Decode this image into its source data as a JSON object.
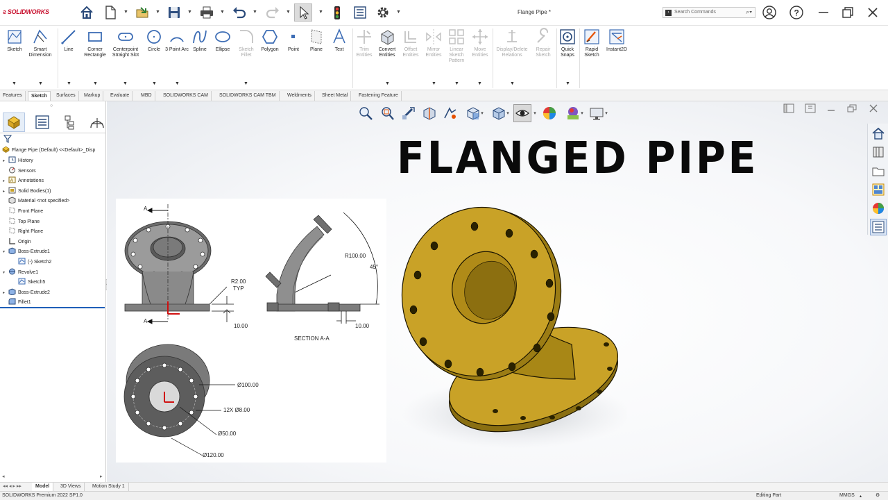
{
  "app": {
    "brand": "SOLIDWORKS",
    "document_title": "Flange Pipe *",
    "search_placeholder": "Search Commands"
  },
  "ribbon": {
    "sketch_group": [
      {
        "label": "Sketch",
        "enabled": true,
        "icon": "sketch-icon"
      },
      {
        "label": "Smart Dimension",
        "enabled": true,
        "icon": "smart-dimension-icon"
      },
      {
        "label": "Line",
        "enabled": true,
        "icon": "line-icon"
      },
      {
        "label": "Corner Rectangle",
        "enabled": true,
        "icon": "rectangle-icon"
      },
      {
        "label": "Centerpoint Straight Slot",
        "enabled": true,
        "icon": "slot-icon"
      },
      {
        "label": "Circle",
        "enabled": true,
        "icon": "circle-icon"
      },
      {
        "label": "3 Point Arc",
        "enabled": true,
        "icon": "arc-icon"
      },
      {
        "label": "Spline",
        "enabled": true,
        "icon": "spline-icon"
      },
      {
        "label": "Ellipse",
        "enabled": true,
        "icon": "ellipse-icon"
      },
      {
        "label": "Sketch Fillet",
        "enabled": false,
        "icon": "sketch-fillet-icon"
      },
      {
        "label": "Polygon",
        "enabled": true,
        "icon": "polygon-icon"
      },
      {
        "label": "Point",
        "enabled": true,
        "icon": "point-icon"
      },
      {
        "label": "Plane",
        "enabled": true,
        "icon": "plane-icon"
      },
      {
        "label": "Text",
        "enabled": true,
        "icon": "text-icon"
      }
    ],
    "entities_group": [
      {
        "label": "Trim Entities",
        "enabled": false,
        "icon": "trim-icon"
      },
      {
        "label": "Convert Entities",
        "enabled": true,
        "icon": "convert-entities-icon"
      },
      {
        "label": "Offset Entities",
        "enabled": false,
        "icon": "offset-icon"
      },
      {
        "label": "Mirror Entities",
        "enabled": false,
        "icon": "mirror-icon"
      },
      {
        "label": "Linear Sketch Pattern",
        "enabled": false,
        "icon": "linear-pattern-icon"
      },
      {
        "label": "Move Entities",
        "enabled": false,
        "icon": "move-icon"
      }
    ],
    "relations_group": [
      {
        "label": "Display/Delete Relations",
        "enabled": false,
        "icon": "relations-icon"
      },
      {
        "label": "Repair Sketch",
        "enabled": false,
        "icon": "repair-icon"
      }
    ],
    "snap_group": [
      {
        "label": "Quick Snaps",
        "enabled": true,
        "icon": "quick-snaps-icon"
      },
      {
        "label": "Rapid Sketch",
        "enabled": true,
        "icon": "rapid-sketch-icon"
      },
      {
        "label": "Instant2D",
        "enabled": true,
        "icon": "instant2d-icon"
      }
    ]
  },
  "tabs": [
    "Features",
    "Sketch",
    "Surfaces",
    "Markup",
    "Evaluate",
    "MBD",
    "SOLIDWORKS CAM",
    "SOLIDWORKS CAM TBM",
    "Weldments",
    "Sheet Metal",
    "Fastening Feature"
  ],
  "active_tab": "Sketch",
  "tree": {
    "root": "Flange Pipe (Default) <<Default>_Disp",
    "items": [
      {
        "label": "History",
        "expandable": true,
        "icon": "history-icon"
      },
      {
        "label": "Sensors",
        "expandable": false,
        "icon": "sensors-icon"
      },
      {
        "label": "Annotations",
        "expandable": true,
        "icon": "annotations-icon"
      },
      {
        "label": "Solid Bodies(1)",
        "expandable": true,
        "icon": "solid-bodies-icon"
      },
      {
        "label": "Material <not specified>",
        "expandable": false,
        "icon": "material-icon"
      },
      {
        "label": "Front Plane",
        "expandable": false,
        "icon": "plane-icon"
      },
      {
        "label": "Top Plane",
        "expandable": false,
        "icon": "plane-icon"
      },
      {
        "label": "Right Plane",
        "expandable": false,
        "icon": "plane-icon"
      },
      {
        "label": "Origin",
        "expandable": false,
        "icon": "origin-icon"
      },
      {
        "label": "Boss-Extrude1",
        "expandable": true,
        "expanded": true,
        "icon": "extrude-icon"
      },
      {
        "label": "(-) Sketch2",
        "expandable": false,
        "indent": 1,
        "icon": "sketch-icon"
      },
      {
        "label": "Revolve1",
        "expandable": true,
        "expanded": true,
        "icon": "revolve-icon"
      },
      {
        "label": "Sketch5",
        "expandable": false,
        "indent": 1,
        "icon": "sketch-icon"
      },
      {
        "label": "Boss-Extrude2",
        "expandable": true,
        "icon": "extrude-icon"
      },
      {
        "label": "Fillet1",
        "expandable": false,
        "icon": "fillet-icon"
      }
    ]
  },
  "graphics": {
    "overlay_title": "FLANGED PIPE",
    "model_color": "#c9a227"
  },
  "drawing": {
    "section_marker": "A",
    "fillet_note": "R2.00",
    "fillet_note_2": "TYP",
    "dim_thickness": "10.00",
    "dim_radius": "R100.00",
    "dim_angle": "45°",
    "dim_thickness_2": "10.00",
    "section_label": "SECTION A-A",
    "dim_outer": "Ø100.00",
    "dim_holes": "12X Ø8.00",
    "dim_bore": "Ø50.00",
    "dim_flange": "Ø120.00"
  },
  "bottom_tabs": [
    "Model",
    "3D Views",
    "Motion Study 1"
  ],
  "active_bottom_tab": "Model",
  "status": {
    "version": "SOLIDWORKS Premium 2022 SP1.0",
    "mode": "Editing Part",
    "units": "MMGS"
  }
}
